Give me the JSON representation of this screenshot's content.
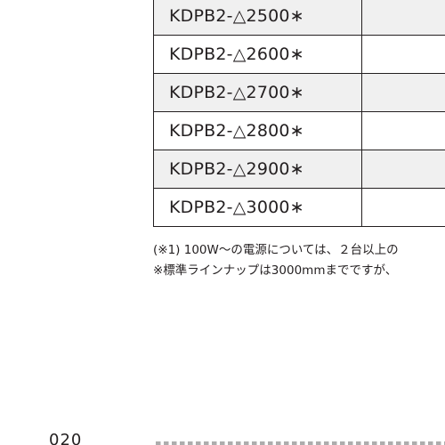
{
  "table": {
    "rows": [
      {
        "code": "KDPB2-△2500∗",
        "shaded": true
      },
      {
        "code": "KDPB2-△2600∗",
        "shaded": false
      },
      {
        "code": "KDPB2-△2700∗",
        "shaded": true
      },
      {
        "code": "KDPB2-△2800∗",
        "shaded": false
      },
      {
        "code": "KDPB2-△2900∗",
        "shaded": true
      },
      {
        "code": "KDPB2-△3000∗",
        "shaded": false
      }
    ]
  },
  "notes": [
    "(※1) 100W～の電源については、２台以上の",
    "※標準ラインナップは3000mmまでですが、"
  ],
  "footer": {
    "page_number": "020"
  }
}
